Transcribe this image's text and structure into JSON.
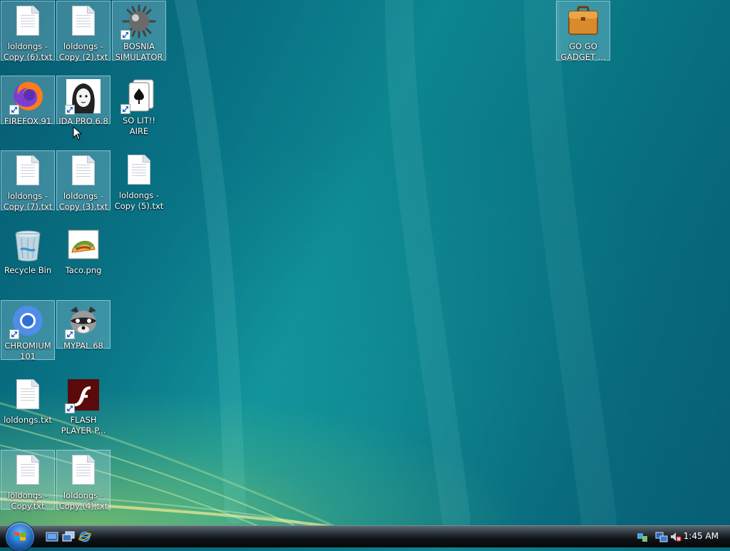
{
  "desktop": {
    "icons": [
      {
        "label": "loldongs - Copy (6).txt",
        "type": "text-file-icon"
      },
      {
        "label": "loldongs - Copy (2).txt",
        "type": "text-file-icon"
      },
      {
        "label": "BOSNIA SIMULATOR",
        "type": "spiked-mine-icon"
      },
      {
        "label": "GO GO GADGET ...",
        "type": "briefcase-icon"
      },
      {
        "label": "FIREFOX 91",
        "type": "firefox-icon"
      },
      {
        "label": "IDA PRO 6.8",
        "type": "ida-portrait-icon"
      },
      {
        "label": "SO LIT!! AIRE",
        "type": "solitaire-cards-icon"
      },
      {
        "label": "loldongs - Copy (7).txt",
        "type": "text-file-icon"
      },
      {
        "label": "loldongs - Copy (3).txt",
        "type": "text-file-icon"
      },
      {
        "label": "loldongs - Copy (5).txt",
        "type": "text-file-icon"
      },
      {
        "label": "Recycle Bin",
        "type": "recycle-bin-icon"
      },
      {
        "label": "Taco.png",
        "type": "taco-image-icon"
      },
      {
        "label": "CHROMIUM 101",
        "type": "chromium-icon"
      },
      {
        "label": "MYPAL 68",
        "type": "raccoon-icon"
      },
      {
        "label": "loldongs.txt",
        "type": "text-file-icon"
      },
      {
        "label": "FLASH PLAYER P...",
        "type": "flash-player-icon"
      },
      {
        "label": "loldongs - Copy.txt",
        "type": "text-file-icon"
      },
      {
        "label": "loldongs - Copy (4).txt",
        "type": "text-file-icon"
      }
    ]
  },
  "taskbar": {
    "start_button": "start-orb-icon",
    "quick_launch": [
      "show-desktop-icon",
      "switch-windows-icon",
      "internet-explorer-icon"
    ],
    "tray_icons": [
      "safely-remove-hardware-icon",
      "network-icon",
      "volume-muted-icon"
    ],
    "clock": "1:45 AM"
  },
  "colors": {
    "wallpaper": "#0f8690",
    "selection": "#bee1f5",
    "taskbar": "#0f1418"
  }
}
